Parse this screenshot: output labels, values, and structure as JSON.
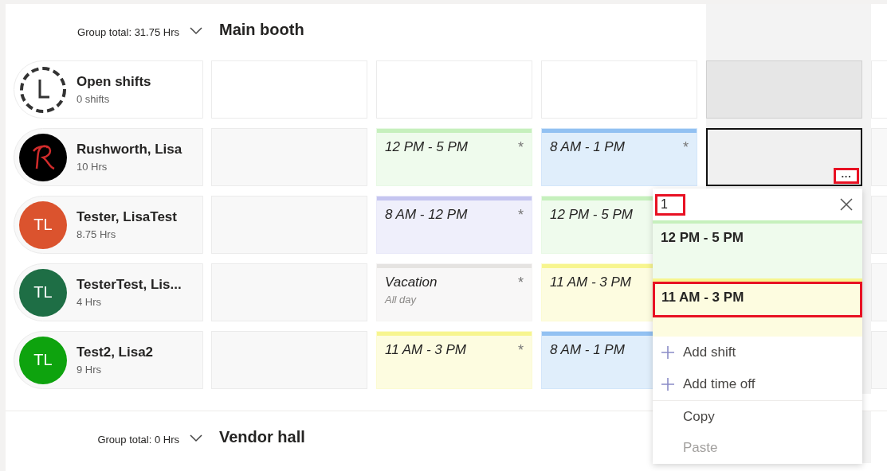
{
  "groups": [
    {
      "total": "Group total: 31.75 Hrs",
      "title": "Main booth",
      "expanded": true,
      "rows": [
        {
          "name": "Open shifts",
          "hours": "0 shifts",
          "avatar": {
            "kind": "open"
          },
          "cells": [
            {
              "kind": "open",
              "today": false
            },
            {
              "kind": "open",
              "today": false
            },
            {
              "kind": "open",
              "today": false
            },
            {
              "kind": "open",
              "today": true
            },
            {
              "kind": "open",
              "today": false
            }
          ]
        },
        {
          "name": "Rushworth, Lisa",
          "hours": "10 Hrs",
          "avatar": {
            "kind": "monogram"
          },
          "cells": [
            {
              "kind": "empty"
            },
            {
              "kind": "shift",
              "time": "12 PM - 5 PM",
              "note": "*",
              "color": "#c6f0bd"
            },
            {
              "kind": "shift",
              "time": "8 AM - 1 PM",
              "note": "*",
              "color": "#92c1f2"
            },
            {
              "kind": "empty",
              "selected": true,
              "more": {
                "label": "···",
                "highlighted": true
              }
            },
            {
              "kind": "empty"
            }
          ]
        },
        {
          "name": "Tester, LisaTest",
          "hours": "8.75 Hrs",
          "avatar": {
            "kind": "initials",
            "initials": "TL",
            "color": "#db532e"
          },
          "cells": [
            {
              "kind": "empty"
            },
            {
              "kind": "shift",
              "time": "8 AM - 12 PM",
              "note": "*",
              "color": "#c5c5f0"
            },
            {
              "kind": "shift",
              "time": "12 PM - 5 PM",
              "color": "#c6f0bd"
            },
            {
              "kind": "empty"
            },
            {
              "kind": "empty"
            }
          ]
        },
        {
          "name": "TesterTest, Lis...",
          "hours": "4 Hrs",
          "avatar": {
            "kind": "initials",
            "initials": "TL",
            "color": "#1e6e45"
          },
          "cells": [
            {
              "kind": "empty"
            },
            {
              "kind": "timeoff",
              "time": "Vacation",
              "sub": "All day",
              "note": "*",
              "color": "#e5e3e1"
            },
            {
              "kind": "shift",
              "time": "11 AM - 3 PM",
              "color": "#f7f58f"
            },
            {
              "kind": "empty"
            },
            {
              "kind": "empty"
            }
          ]
        },
        {
          "name": "Test2, Lisa2",
          "hours": "9 Hrs",
          "avatar": {
            "kind": "initials",
            "initials": "TL",
            "color": "#0ea30e"
          },
          "cells": [
            {
              "kind": "empty"
            },
            {
              "kind": "shift",
              "time": "11 AM - 3 PM",
              "note": "*",
              "color": "#f7f58f"
            },
            {
              "kind": "shift",
              "time": "8 AM - 1 PM",
              "color": "#92c1f2"
            },
            {
              "kind": "empty"
            },
            {
              "kind": "empty"
            }
          ]
        }
      ]
    },
    {
      "total": "Group total: 0 Hrs",
      "title": "Vendor hall",
      "expanded": true
    }
  ],
  "popup": {
    "search": {
      "value": "1",
      "highlighted": true
    },
    "options": [
      {
        "time": "12 PM - 5 PM",
        "color": "#c6f0bd",
        "highlighted": false
      },
      {
        "time": "11 AM - 3 PM",
        "color": "#f7f58f",
        "highlighted": true
      }
    ],
    "actions": [
      {
        "kind": "add",
        "label": "Add shift",
        "disabled": false
      },
      {
        "kind": "add",
        "label": "Add time off",
        "disabled": false
      },
      {
        "kind": "plain",
        "label": "Copy",
        "disabled": false
      },
      {
        "kind": "plain",
        "label": "Paste",
        "disabled": true
      }
    ]
  }
}
